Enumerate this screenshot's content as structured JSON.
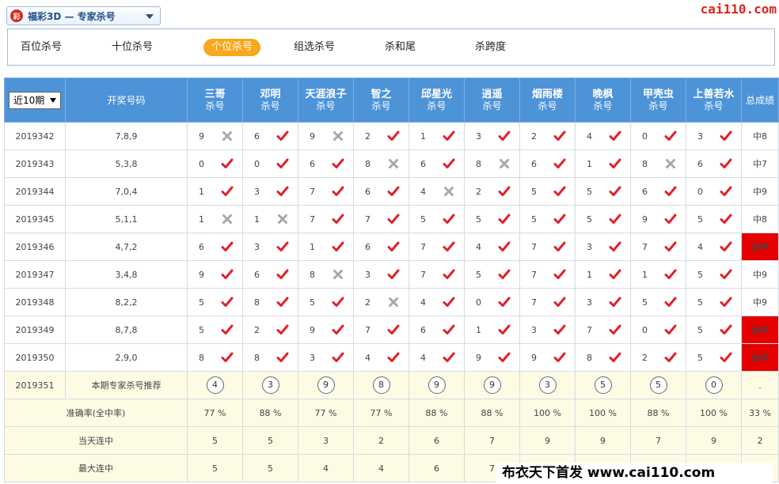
{
  "topbar": {
    "logo_text": "彩",
    "lottery_label": "福彩3D — 专家杀号",
    "site_logo": "cai110.com"
  },
  "tabs": [
    {
      "label": "百位杀号",
      "active": false
    },
    {
      "label": "十位杀号",
      "active": false
    },
    {
      "label": "个位杀号",
      "active": true
    },
    {
      "label": "组选杀号",
      "active": false
    },
    {
      "label": "杀和尾",
      "active": false
    },
    {
      "label": "杀跨度",
      "active": false
    }
  ],
  "table": {
    "period_select": "近10期",
    "draw_header": "开奖号码",
    "total_header": "总成绩",
    "expert_sub": "杀号",
    "experts": [
      "三哥",
      "邓明",
      "天涯浪子",
      "智之",
      "邱星光",
      "逍遥",
      "烟雨楼",
      "晚枫",
      "甲壳虫",
      "上善若水"
    ],
    "rows": [
      {
        "issue": "2019342",
        "draw": "7,8,9",
        "picks": [
          [
            9,
            "x"
          ],
          [
            6,
            "v"
          ],
          [
            9,
            "x"
          ],
          [
            2,
            "v"
          ],
          [
            1,
            "v"
          ],
          [
            3,
            "v"
          ],
          [
            2,
            "v"
          ],
          [
            4,
            "v"
          ],
          [
            0,
            "v"
          ],
          [
            3,
            "v"
          ]
        ],
        "total": "中8",
        "full": false
      },
      {
        "issue": "2019343",
        "draw": "5,3,8",
        "picks": [
          [
            0,
            "v"
          ],
          [
            0,
            "v"
          ],
          [
            6,
            "v"
          ],
          [
            8,
            "x"
          ],
          [
            6,
            "v"
          ],
          [
            8,
            "x"
          ],
          [
            6,
            "v"
          ],
          [
            1,
            "v"
          ],
          [
            8,
            "x"
          ],
          [
            6,
            "v"
          ]
        ],
        "total": "中7",
        "full": false
      },
      {
        "issue": "2019344",
        "draw": "7,0,4",
        "picks": [
          [
            1,
            "v"
          ],
          [
            3,
            "v"
          ],
          [
            7,
            "v"
          ],
          [
            6,
            "v"
          ],
          [
            4,
            "x"
          ],
          [
            2,
            "v"
          ],
          [
            5,
            "v"
          ],
          [
            5,
            "v"
          ],
          [
            6,
            "v"
          ],
          [
            0,
            "v"
          ]
        ],
        "total": "中9",
        "full": false
      },
      {
        "issue": "2019345",
        "draw": "5,1,1",
        "picks": [
          [
            1,
            "x"
          ],
          [
            1,
            "x"
          ],
          [
            7,
            "v"
          ],
          [
            7,
            "v"
          ],
          [
            5,
            "v"
          ],
          [
            5,
            "v"
          ],
          [
            5,
            "v"
          ],
          [
            5,
            "v"
          ],
          [
            9,
            "v"
          ],
          [
            5,
            "v"
          ]
        ],
        "total": "中8",
        "full": false
      },
      {
        "issue": "2019346",
        "draw": "4,7,2",
        "picks": [
          [
            6,
            "v"
          ],
          [
            3,
            "v"
          ],
          [
            1,
            "v"
          ],
          [
            6,
            "v"
          ],
          [
            7,
            "v"
          ],
          [
            4,
            "v"
          ],
          [
            7,
            "v"
          ],
          [
            3,
            "v"
          ],
          [
            7,
            "v"
          ],
          [
            4,
            "v"
          ]
        ],
        "total": "全中",
        "full": true
      },
      {
        "issue": "2019347",
        "draw": "3,4,8",
        "picks": [
          [
            9,
            "v"
          ],
          [
            6,
            "v"
          ],
          [
            8,
            "x"
          ],
          [
            3,
            "v"
          ],
          [
            7,
            "v"
          ],
          [
            5,
            "v"
          ],
          [
            7,
            "v"
          ],
          [
            1,
            "v"
          ],
          [
            1,
            "v"
          ],
          [
            5,
            "v"
          ]
        ],
        "total": "中9",
        "full": false
      },
      {
        "issue": "2019348",
        "draw": "8,2,2",
        "picks": [
          [
            5,
            "v"
          ],
          [
            8,
            "v"
          ],
          [
            5,
            "v"
          ],
          [
            2,
            "x"
          ],
          [
            4,
            "v"
          ],
          [
            0,
            "v"
          ],
          [
            7,
            "v"
          ],
          [
            3,
            "v"
          ],
          [
            5,
            "v"
          ],
          [
            5,
            "v"
          ]
        ],
        "total": "中9",
        "full": false
      },
      {
        "issue": "2019349",
        "draw": "8,7,8",
        "picks": [
          [
            5,
            "v"
          ],
          [
            2,
            "v"
          ],
          [
            9,
            "v"
          ],
          [
            7,
            "v"
          ],
          [
            6,
            "v"
          ],
          [
            1,
            "v"
          ],
          [
            3,
            "v"
          ],
          [
            7,
            "v"
          ],
          [
            0,
            "v"
          ],
          [
            5,
            "v"
          ]
        ],
        "total": "全中",
        "full": true
      },
      {
        "issue": "2019350",
        "draw": "2,9,0",
        "picks": [
          [
            8,
            "v"
          ],
          [
            8,
            "v"
          ],
          [
            3,
            "v"
          ],
          [
            4,
            "v"
          ],
          [
            4,
            "v"
          ],
          [
            9,
            "v"
          ],
          [
            9,
            "v"
          ],
          [
            8,
            "v"
          ],
          [
            2,
            "v"
          ],
          [
            5,
            "v"
          ]
        ],
        "total": "全中",
        "full": true
      }
    ],
    "recommend": {
      "issue": "2019351",
      "label": "本期专家杀号推荐",
      "values": [
        "4",
        "3",
        "9",
        "8",
        "9",
        "9",
        "3",
        "5",
        "5",
        "0"
      ],
      "total": "."
    },
    "stats": [
      {
        "label": "准确率(全中率)",
        "values": [
          "77 %",
          "88 %",
          "77 %",
          "77 %",
          "88 %",
          "88 %",
          "100 %",
          "100 %",
          "88 %",
          "100 %"
        ],
        "total": "33 %"
      },
      {
        "label": "当天连中",
        "values": [
          "5",
          "5",
          "3",
          "2",
          "6",
          "7",
          "9",
          "9",
          "7",
          "9"
        ],
        "total": "2"
      },
      {
        "label": "最大连中",
        "values": [
          "5",
          "5",
          "4",
          "4",
          "6",
          "7",
          "",
          "",
          "",
          ""
        ],
        "total": ""
      }
    ]
  },
  "watermark": "布衣天下首发 www.cai110.com"
}
